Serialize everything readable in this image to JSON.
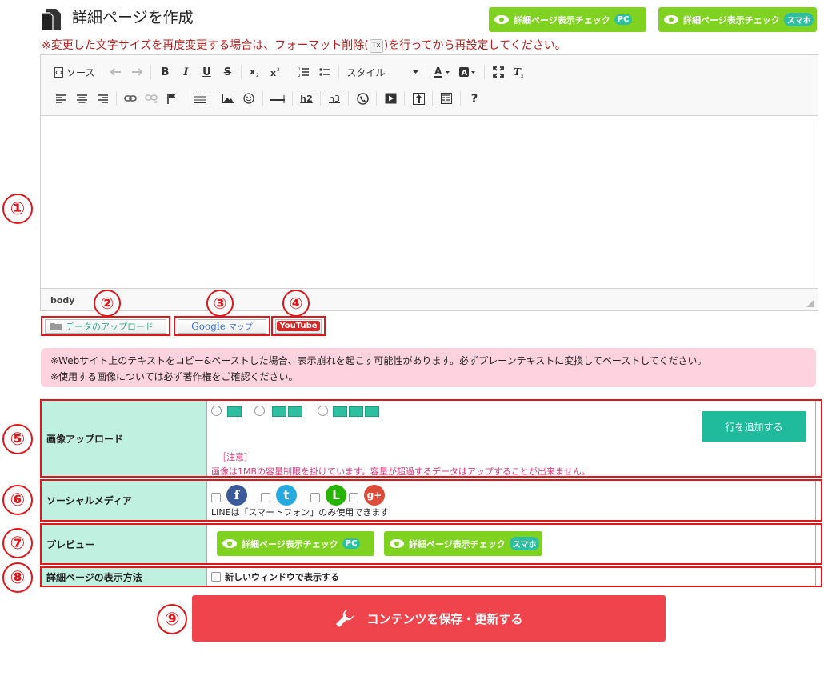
{
  "header": {
    "title": "詳細ページを作成",
    "preview_pc": {
      "label": "詳細ページ表示チェック",
      "badge": "PC"
    },
    "preview_sp": {
      "label": "詳細ページ表示チェック",
      "badge": "スマホ"
    }
  },
  "warning": {
    "before": "※変更した文字サイズを再度変更する場合は、フォーマット削除(",
    "icon_text": "Tx",
    "after": ")を行ってから再設定してください。"
  },
  "editor": {
    "source_label": "ソース",
    "style_label": "スタイル",
    "bold": "B",
    "italic": "I",
    "underline": "U",
    "strike": "S",
    "h2": "h2",
    "h3": "h3",
    "help": "?",
    "footer_path": "body"
  },
  "markers": [
    "①",
    "②",
    "③",
    "④",
    "⑤",
    "⑥",
    "⑦",
    "⑧",
    "⑨"
  ],
  "plugins": {
    "upload": "データのアップロード",
    "google_prefix": "Google",
    "google_suffix": "マップ",
    "youtube": "YouTube"
  },
  "notice": {
    "line1": "※Webサイト上のテキストをコピー&ペーストした場合、表示崩れを起こす可能性があります。必ずプレーンテキストに変換してペーストしてください。",
    "line2": "※使用する画像については必ず著作権をご確認ください。"
  },
  "form": {
    "image_upload": {
      "label": "画像アップロード",
      "add_row": "行を追加する",
      "note_title": "［注意］",
      "note_body": "画像は1MBの容量制限を掛けています。容量が超過するデータはアップすることが出来ません。"
    },
    "social": {
      "label": "ソーシャルメディア",
      "facebook": "f",
      "twitter": "t",
      "line": "L",
      "gplus": "g+",
      "note": "LINEは「スマートフォン」のみ使用できます"
    },
    "preview": {
      "label": "プレビュー",
      "pc": {
        "label": "詳細ページ表示チェック",
        "badge": "PC"
      },
      "sp": {
        "label": "詳細ページ表示チェック",
        "badge": "スマホ"
      }
    },
    "display": {
      "label": "詳細ページの表示方法",
      "option": "新しいウィンドウで表示する"
    }
  },
  "save": {
    "label": "コンテンツを保存・更新する"
  },
  "colors": {
    "accent_green": "#7fd320",
    "teal": "#1fbb9c",
    "red": "#e0161b",
    "save": "#f0444d",
    "notice_bg": "#ffd2df"
  }
}
